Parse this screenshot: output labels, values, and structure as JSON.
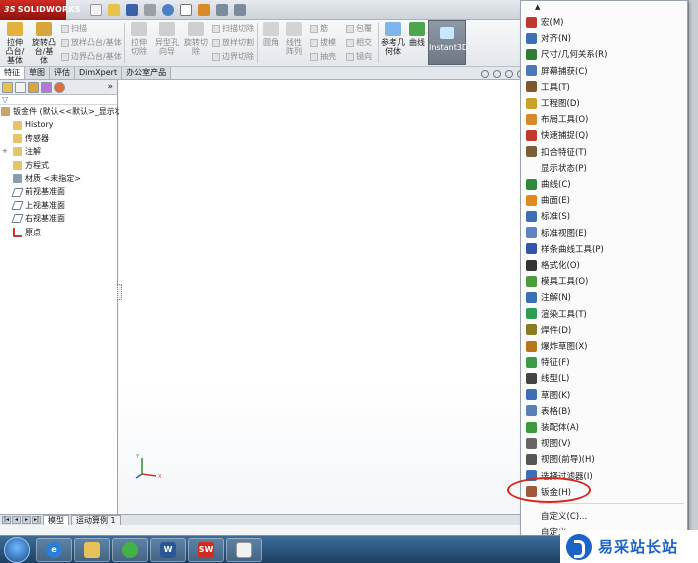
{
  "app": {
    "logo_text": "SOLIDWORKS",
    "logo_prefix": "3S"
  },
  "ribbon": {
    "big_buttons": [
      {
        "label": "拉伸凸台/基体"
      },
      {
        "label": "旋转凸台/基体"
      },
      {
        "label": "拉伸切除"
      },
      {
        "label": "异型孔向导"
      },
      {
        "label": "旋转切除"
      },
      {
        "label": "圆角"
      },
      {
        "label": "线性阵列"
      },
      {
        "label": "参考几何体"
      },
      {
        "label": "曲线"
      },
      {
        "label": "Instant3D"
      }
    ],
    "small_col_1": [
      "扫描",
      "放样凸台/基体",
      "边界凸台/基体"
    ],
    "small_col_2": [
      "扫描切除",
      "放样切割",
      "边界切除"
    ],
    "small_col_3": [
      "筋",
      "拔模",
      "抽壳"
    ],
    "small_col_4": [
      "包覆",
      "相交",
      "镜向"
    ]
  },
  "tabs": [
    "特征",
    "草图",
    "评估",
    "DimXpert",
    "办公室产品"
  ],
  "tree": {
    "root": "钣金件 (默认<<默认>_显示状",
    "items": [
      {
        "label": "History",
        "expandable": false
      },
      {
        "label": "传感器",
        "expandable": false
      },
      {
        "label": "注解",
        "expandable": true
      },
      {
        "label": "方程式",
        "expandable": false
      },
      {
        "label": "材质 <未指定>",
        "expandable": false
      },
      {
        "label": "前视基准面",
        "expandable": false
      },
      {
        "label": "上视基准面",
        "expandable": false
      },
      {
        "label": "右视基准面",
        "expandable": false
      },
      {
        "label": "原点",
        "expandable": false
      }
    ]
  },
  "bottom_tabs": [
    "模型",
    "运动算例 1"
  ],
  "menu": {
    "items": [
      {
        "label": "宏(M)",
        "icon": "macro-icon",
        "color": "#c0392b"
      },
      {
        "label": "对齐(N)",
        "icon": "align-icon",
        "color": "#3d6fb6"
      },
      {
        "label": "尺寸/几何关系(R)",
        "icon": "dimension-icon",
        "color": "#2e7d32"
      },
      {
        "label": "屏幕捕获(C)",
        "icon": "screen-capture-icon",
        "color": "#4a78b8"
      },
      {
        "label": "工具(T)",
        "icon": "tools-icon",
        "color": "#7a5a2b"
      },
      {
        "label": "工程图(D)",
        "icon": "drawing-icon",
        "color": "#c9a227"
      },
      {
        "label": "布局工具(O)",
        "icon": "layout-tools-icon",
        "color": "#d48a2c"
      },
      {
        "label": "快速捕捉(Q)",
        "icon": "quick-snap-icon",
        "color": "#c0392b"
      },
      {
        "label": "扣合特征(T)",
        "icon": "fastening-feature-icon",
        "color": "#7b5e3a"
      },
      {
        "label": "显示状态(P)",
        "icon": "",
        "color": ""
      },
      {
        "label": "曲线(C)",
        "icon": "curve-icon",
        "color": "#2e8b3a"
      },
      {
        "label": "曲面(E)",
        "icon": "surface-icon",
        "color": "#e08a1e"
      },
      {
        "label": "标准(S)",
        "icon": "standard-icon",
        "color": "#3d6fb6"
      },
      {
        "label": "标准视图(E)",
        "icon": "standard-views-icon",
        "color": "#5d83c2"
      },
      {
        "label": "样条曲线工具(P)",
        "icon": "spline-tools-icon",
        "color": "#3355aa"
      },
      {
        "label": "格式化(O)",
        "icon": "format-icon",
        "color": "#333333"
      },
      {
        "label": "模具工具(O)",
        "icon": "mold-tools-icon",
        "color": "#4c9c3c"
      },
      {
        "label": "注解(N)",
        "icon": "annotation-icon",
        "color": "#3d6fb6"
      },
      {
        "label": "渲染工具(T)",
        "icon": "render-tools-icon",
        "color": "#2f9e55"
      },
      {
        "label": "焊件(D)",
        "icon": "weldment-icon",
        "color": "#8a7a22"
      },
      {
        "label": "爆炸草图(X)",
        "icon": "explode-sketch-icon",
        "color": "#b9751e"
      },
      {
        "label": "特征(F)",
        "icon": "features-icon",
        "color": "#3c9b46"
      },
      {
        "label": "线型(L)",
        "icon": "line-format-icon",
        "color": "#444444"
      },
      {
        "label": "草图(K)",
        "icon": "sketch-icon",
        "color": "#3d6fb6"
      },
      {
        "label": "表格(B)",
        "icon": "table-icon",
        "color": "#5a7fb8"
      },
      {
        "label": "装配体(A)",
        "icon": "assembly-icon",
        "color": "#3b9a3b"
      },
      {
        "label": "视图(V)",
        "icon": "view-icon",
        "color": "#666666"
      },
      {
        "label": "视图(前导)(H)",
        "icon": "heads-up-view-icon",
        "color": "#555555"
      },
      {
        "label": "选择过滤器(I)",
        "icon": "selection-filter-icon",
        "color": "#3d6fb6"
      },
      {
        "label": "钣金(H)",
        "icon": "sheet-metal-icon",
        "color": "#a0563a"
      }
    ],
    "customize_label": "自定义(C)...",
    "partial_label": "自定义",
    "highlight_color": "#d7261e"
  },
  "watermark": {
    "text": "易采站长站"
  }
}
